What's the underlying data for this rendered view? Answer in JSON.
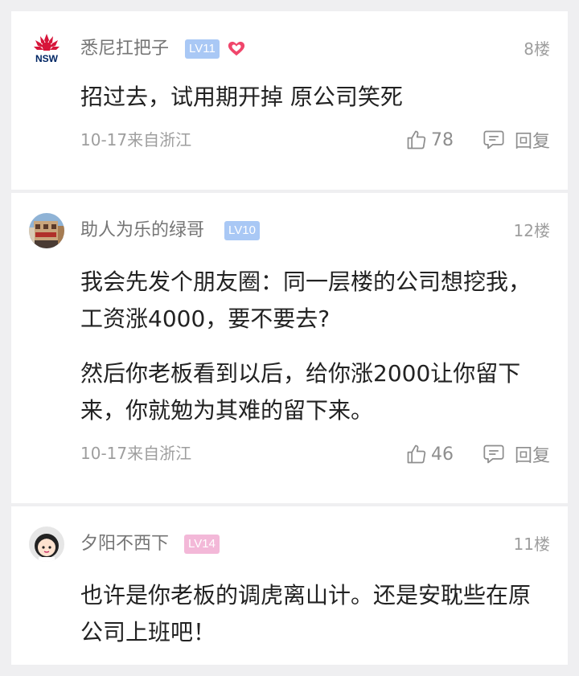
{
  "comments": [
    {
      "username": "悉尼扛把子",
      "level": "LV11",
      "level_color": "#a9c8f5",
      "has_heart_badge": true,
      "floor": "8楼",
      "avatar_icon": "nsw-waratah-logo",
      "avatar_text": "NSW",
      "content": [
        "招过去，试用期开掉 原公司笑死"
      ],
      "meta": "10-17来自浙江",
      "likes": "78",
      "reply_label": "回复"
    },
    {
      "username": "助人为乐的绿哥",
      "level": "LV10",
      "level_color": "#a9c8f5",
      "has_heart_badge": false,
      "floor": "12楼",
      "avatar_icon": "building-photo-avatar",
      "content": [
        "我会先发个朋友圈：同一层楼的公司想挖我，工资涨4000，要不要去?",
        "然后你老板看到以后，给你涨2000让你留下来，你就勉为其难的留下来。"
      ],
      "meta": "10-17来自浙江",
      "likes": "46",
      "reply_label": "回复"
    },
    {
      "username": "夕阳不西下",
      "level": "LV14",
      "level_color": "#f3b8d8",
      "has_heart_badge": false,
      "floor": "11楼",
      "avatar_icon": "cartoon-girl-avatar",
      "content": [
        "也许是你老板的调虎离山计。还是安耽些在原公司上班吧！"
      ]
    }
  ]
}
